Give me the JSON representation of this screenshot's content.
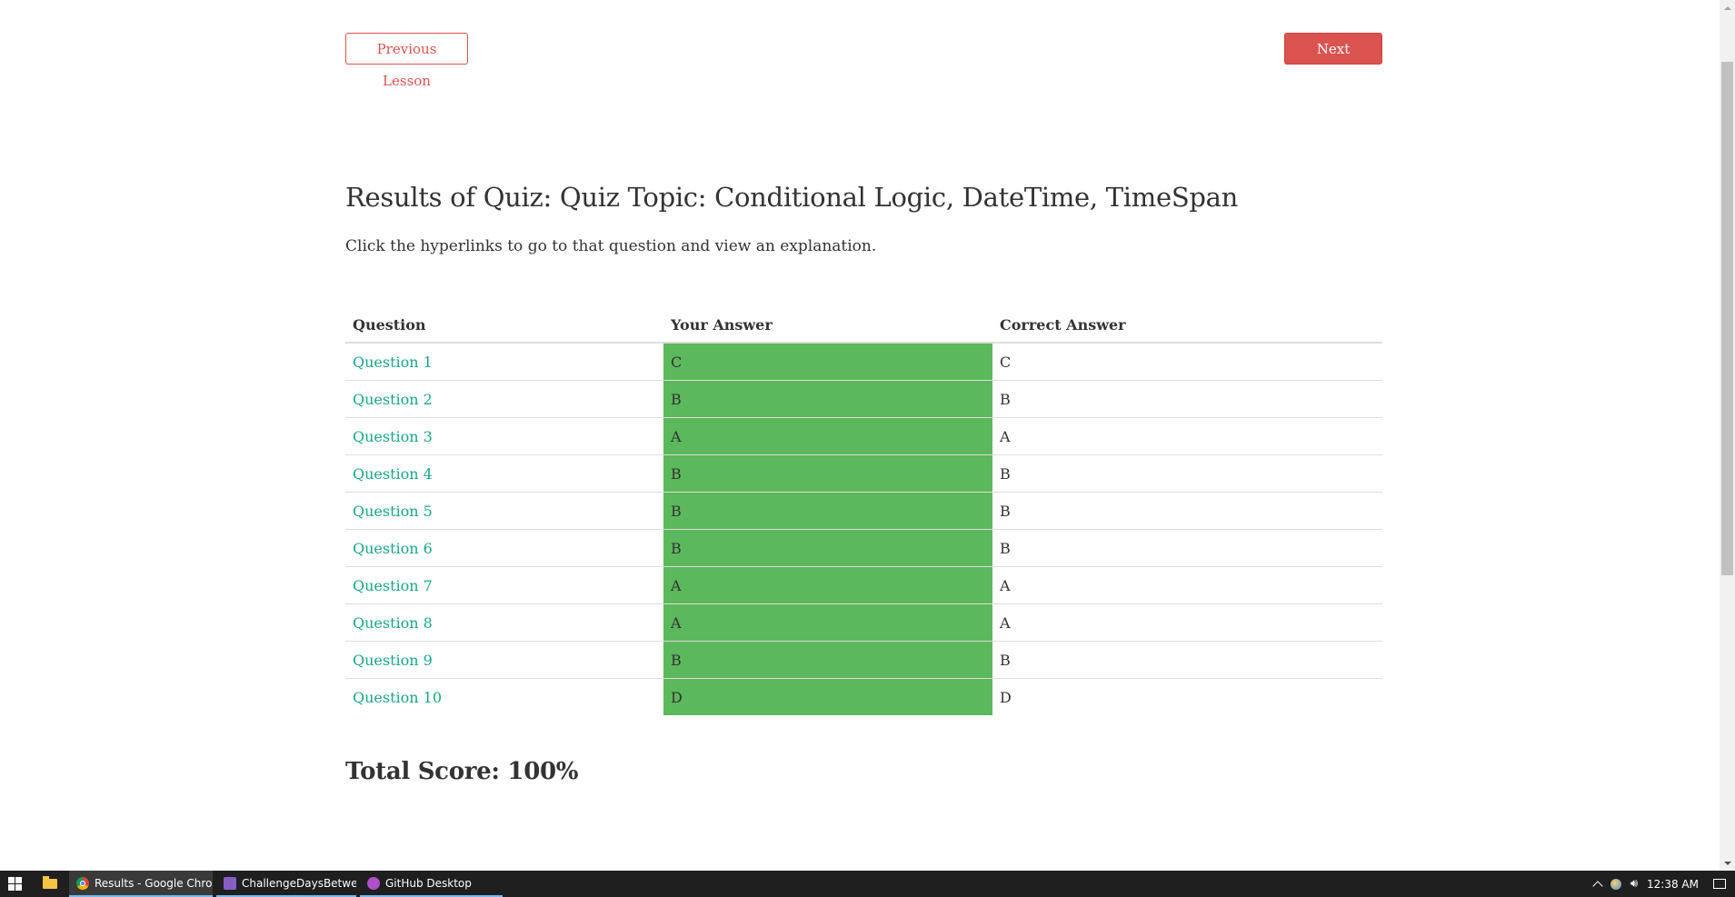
{
  "nav": {
    "previous_label": "Previous Lesson",
    "next_label": "Next Lesson"
  },
  "page": {
    "title": "Results of Quiz: Quiz Topic: Conditional Logic, DateTime, TimeSpan",
    "description": "Click the hyperlinks to go to that question and view an explanation."
  },
  "table": {
    "headers": [
      "Question",
      "Your Answer",
      "Correct Answer"
    ],
    "rows": [
      {
        "question": "Question 1",
        "your_answer": "C",
        "correct_answer": "C"
      },
      {
        "question": "Question 2",
        "your_answer": "B",
        "correct_answer": "B"
      },
      {
        "question": "Question 3",
        "your_answer": "A",
        "correct_answer": "A"
      },
      {
        "question": "Question 4",
        "your_answer": "B",
        "correct_answer": "B"
      },
      {
        "question": "Question 5",
        "your_answer": "B",
        "correct_answer": "B"
      },
      {
        "question": "Question 6",
        "your_answer": "B",
        "correct_answer": "B"
      },
      {
        "question": "Question 7",
        "your_answer": "A",
        "correct_answer": "A"
      },
      {
        "question": "Question 8",
        "your_answer": "A",
        "correct_answer": "A"
      },
      {
        "question": "Question 9",
        "your_answer": "B",
        "correct_answer": "B"
      },
      {
        "question": "Question 10",
        "your_answer": "D",
        "correct_answer": "D"
      }
    ]
  },
  "total_score": "Total Score: 100%",
  "colors": {
    "danger": "#d9534f",
    "correct": "#5cb85c",
    "link": "#18a689"
  },
  "taskbar": {
    "tasks": [
      {
        "label": "Results - Google Chro...",
        "icon": "chrome-icon"
      },
      {
        "label": "ChallengeDaysBetwe...",
        "icon": "visual-studio-icon"
      },
      {
        "label": "GitHub Desktop",
        "icon": "github-desktop-icon"
      }
    ],
    "clock": "12:38 AM"
  }
}
